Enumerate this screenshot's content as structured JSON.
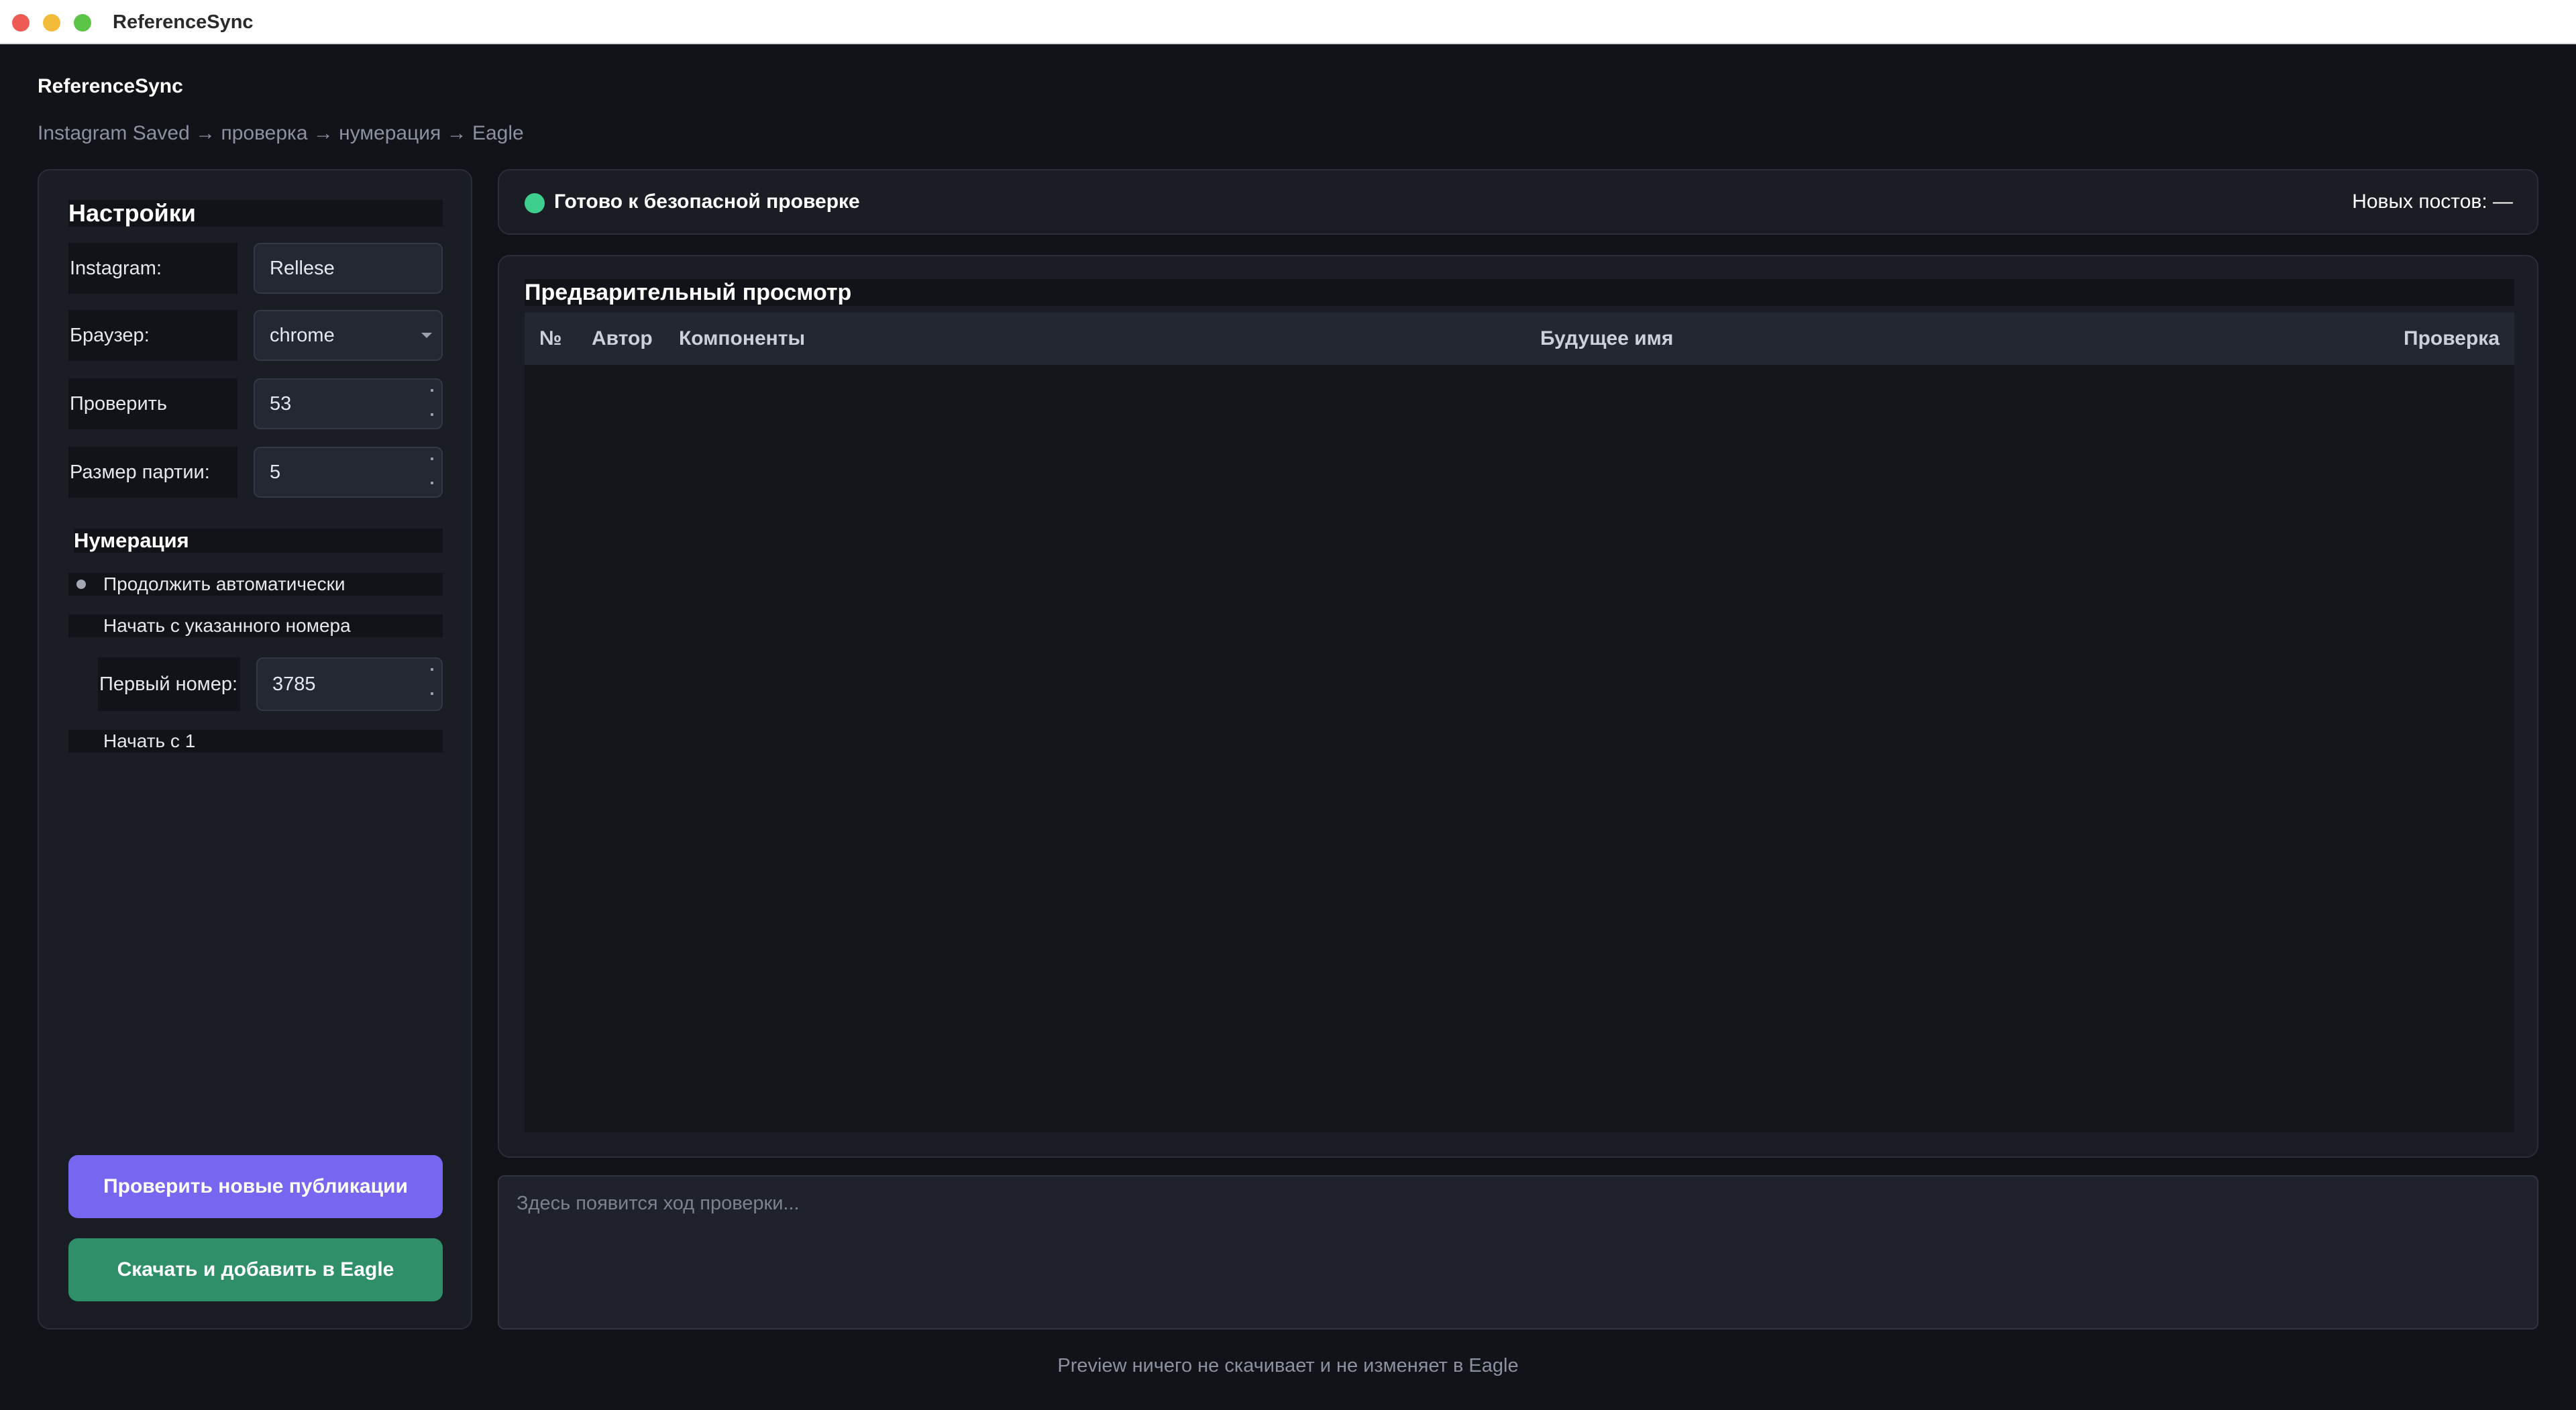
{
  "window": {
    "title": "ReferenceSync"
  },
  "header": {
    "app_title": "ReferenceSync",
    "breadcrumb": "Instagram Saved → проверка → нумерация → Eagle"
  },
  "settings": {
    "title": "Настройки",
    "instagram_label": "Instagram:",
    "instagram_value": "Rellese",
    "browser_label": "Браузер:",
    "browser_value": "chrome",
    "check_posts_label": "Проверить постов:",
    "check_posts_value": "53",
    "batch_size_label": "Размер партии:",
    "batch_size_value": "5"
  },
  "numbering": {
    "title": "Нумерация",
    "options": [
      {
        "label": "Продолжить автоматически",
        "selected": true
      },
      {
        "label": "Начать с указанного номера",
        "selected": false
      },
      {
        "label": "Начать с 1",
        "selected": false
      }
    ],
    "first_number_label": "Первый номер:",
    "first_number_value": "3785"
  },
  "buttons": {
    "check_new": "Проверить новые публикации",
    "download_add": "Скачать и добавить в Eagle"
  },
  "status": {
    "text": "Готово к безопасной проверке",
    "new_posts": "Новых постов: —",
    "color": "#3ecf8e"
  },
  "preview": {
    "title": "Предварительный просмотр",
    "columns": [
      "№",
      "Автор",
      "Компоненты",
      "Будущее имя",
      "Проверка"
    ],
    "rows": []
  },
  "log": {
    "placeholder": "Здесь появится ход проверки..."
  },
  "footer": {
    "note": "Preview ничего не скачивает и не изменяет в Eagle"
  },
  "colors": {
    "accent_purple": "#7766f0",
    "accent_green": "#2f8f68",
    "background": "#111318"
  }
}
